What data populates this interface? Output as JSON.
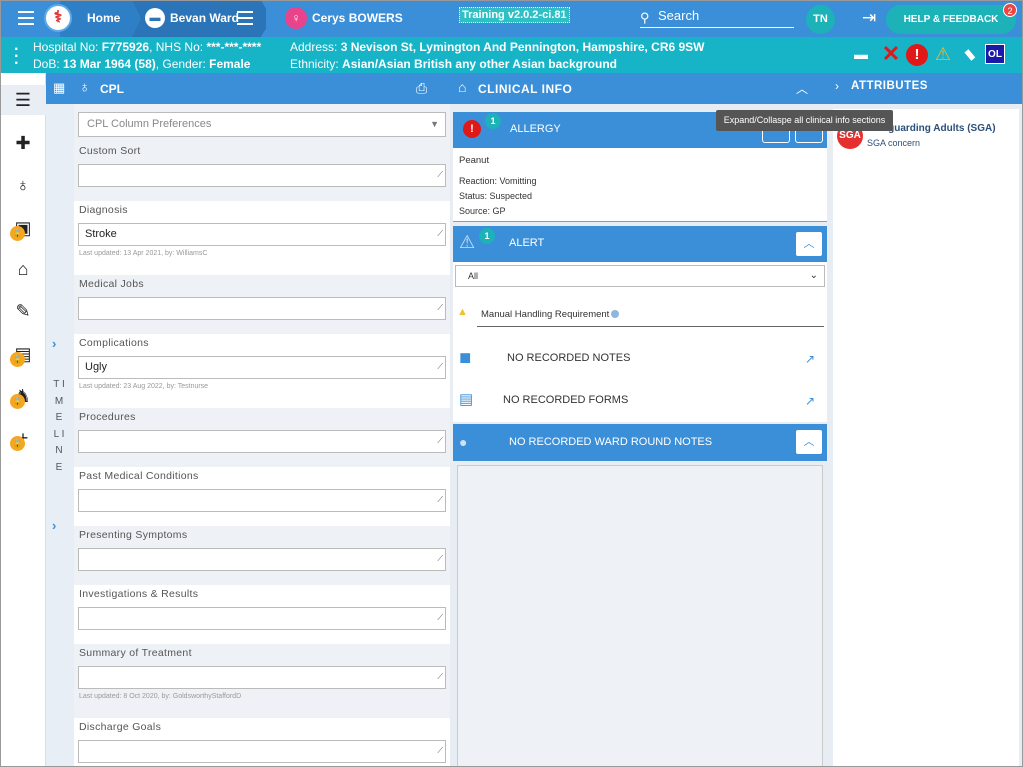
{
  "topbar": {
    "home_label": "Home",
    "ward_label": "Bevan Ward",
    "patient_label": "Cerys BOWERS",
    "training_label": "Training v2.0.2-ci.81",
    "search_label": "Search",
    "avatar_initials": "TN",
    "help_label": "HELP & FEEDBACK",
    "help_badge": "2"
  },
  "patient": {
    "hospital_prefix": "Hospital No: ",
    "hospital_no": "F775926",
    "nhs_prefix": ", NHS No: ",
    "nhs_no": "***-***-****",
    "dob_prefix": "DoB: ",
    "dob": "13 Mar 1964 (58)",
    "gender_prefix": ", Gender: ",
    "gender": "Female",
    "address_prefix": "Address: ",
    "address": "3 Nevison St, Lymington And Pennington, Hampshire, CR6 9SW",
    "ethnicity_prefix": "Ethnicity: ",
    "ethnicity": "Asian/Asian British any other Asian background",
    "ol_label": "OL"
  },
  "cpl": {
    "title": "CPL",
    "select_placeholder": "CPL Column Preferences",
    "timeline_label": "T I M E L I N E",
    "sections": [
      {
        "label": "Custom Sort",
        "value": "",
        "updated": ""
      },
      {
        "label": "Diagnosis",
        "value": "Stroke",
        "updated": "Last updated: 13 Apr 2021, by: WilliamsC"
      },
      {
        "label": "Medical Jobs",
        "value": "",
        "updated": ""
      },
      {
        "label": "Complications",
        "value": "Ugly",
        "updated": "Last updated: 23 Aug 2022, by: Testnurse"
      },
      {
        "label": "Procedures",
        "value": "",
        "updated": ""
      },
      {
        "label": "Past Medical Conditions",
        "value": "",
        "updated": ""
      },
      {
        "label": "Presenting Symptoms",
        "value": "",
        "updated": ""
      },
      {
        "label": "Investigations & Results",
        "value": "",
        "updated": ""
      },
      {
        "label": "Summary of Treatment",
        "value": "",
        "updated": "Last updated: 8 Oct 2020, by: GoldsworthyStaffordD"
      },
      {
        "label": "Discharge Goals",
        "value": "",
        "updated": ""
      }
    ]
  },
  "clinical": {
    "title": "CLINICAL INFO",
    "tooltip": "Expand/Collaspe all clinical info sections",
    "allergy": {
      "title": "ALLERGY",
      "count": "1",
      "name": "Peanut",
      "reaction": "Reaction: Vomitting",
      "status": "Status: Suspected",
      "source": "Source: GP"
    },
    "alert": {
      "title": "ALERT",
      "count": "1",
      "filter": "All",
      "item": "Manual Handling Requirement"
    },
    "notes_label": "NO RECORDED NOTES",
    "forms_label": "NO RECORDED FORMS",
    "ward_round_label": "NO RECORDED WARD ROUND NOTES"
  },
  "attributes": {
    "title": "ATTRIBUTES",
    "sga_icon": "SGA",
    "sga_title": "Safeguarding Adults (SGA)",
    "sga_sub": "SGA concern"
  }
}
